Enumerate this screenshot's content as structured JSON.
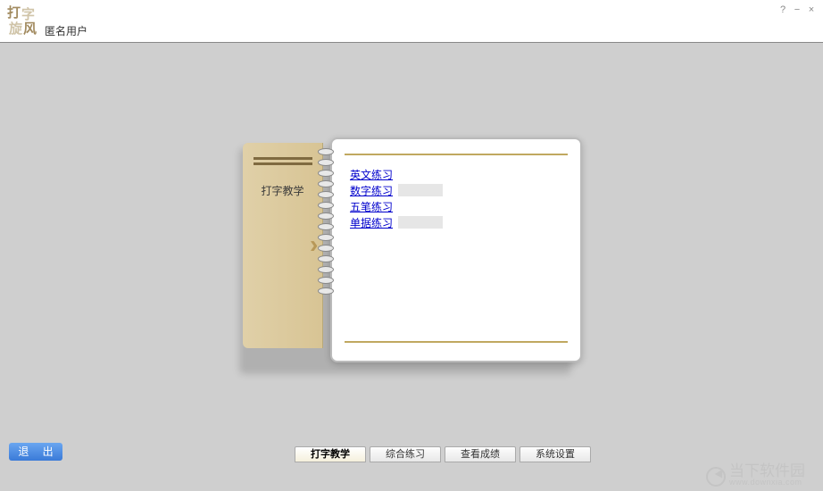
{
  "header": {
    "logo_chars": [
      "打",
      "字",
      "旋",
      "风"
    ],
    "username": "匿名用户"
  },
  "notebook": {
    "left_title": "打字教学",
    "links": [
      {
        "label": "英文练习",
        "highlighted": false
      },
      {
        "label": "数字练习",
        "highlighted": true
      },
      {
        "label": "五笔练习",
        "highlighted": false
      },
      {
        "label": "单据练习",
        "highlighted": true
      }
    ]
  },
  "controls": {
    "exit_label": "退 出",
    "tabs": [
      {
        "label": "打字教学",
        "active": true
      },
      {
        "label": "综合练习",
        "active": false
      },
      {
        "label": "查看成绩",
        "active": false
      },
      {
        "label": "系统设置",
        "active": false
      }
    ]
  },
  "watermark": {
    "line1": "当下软件园",
    "line2": "www.downxia.com"
  }
}
